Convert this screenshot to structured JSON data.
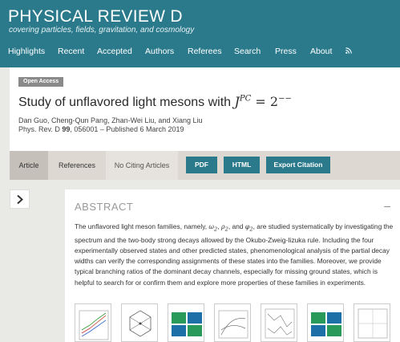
{
  "journal": {
    "title": "PHYSICAL REVIEW D",
    "subtitle": "covering particles, fields, gravitation, and cosmology"
  },
  "nav": {
    "items": [
      "Highlights",
      "Recent",
      "Accepted",
      "Authors",
      "Referees",
      "Search",
      "Press",
      "About"
    ]
  },
  "article": {
    "badge": "Open Access",
    "title_prefix": "Study of unflavored light mesons with ",
    "title_math": "J",
    "title_sup": "PC",
    "title_suffix": " = 2",
    "title_suffix_sup": "−−",
    "authors": "Dan Guo, Cheng-Qun Pang, Zhan-Wei Liu, and Xiang Liu",
    "journal_ref": "Phys. Rev. D ",
    "volume": "99",
    "pub_rest": ", 056001 – Published 6 March 2019"
  },
  "tabs": {
    "article": "Article",
    "references": "References",
    "citing": "No Citing Articles",
    "pdf": "PDF",
    "html": "HTML",
    "export": "Export Citation"
  },
  "abstract": {
    "heading": "ABSTRACT",
    "collapse": "–",
    "text_1": "The unflavored light meson families, namely, ",
    "m1": "ω",
    "m1sub": "2",
    "m2": "ρ",
    "m2sub": "2",
    "m3": "φ",
    "m3sub": "2",
    "text_2": ", are studied systematically by investigating the spectrum and the two-body strong decays allowed by the Okubo-Zweig-Iizuka rule. Including the four experimentally observed states and other predicted states, phenomenological analysis of the partial decay widths can verify the corresponding assignments of these states into the families. Moreover, we provide typical branching ratios of the dominant decay channels, especially for missing ground states, which is helpful to search for or confirm them and explore more properties of these families in experiments."
  },
  "colors": {
    "brand": "#2a7a8c",
    "tab_bg": "#ddd8d2",
    "badge": "#8a8a8a"
  },
  "icons": [
    "rss-icon",
    "chevron-right-icon"
  ]
}
